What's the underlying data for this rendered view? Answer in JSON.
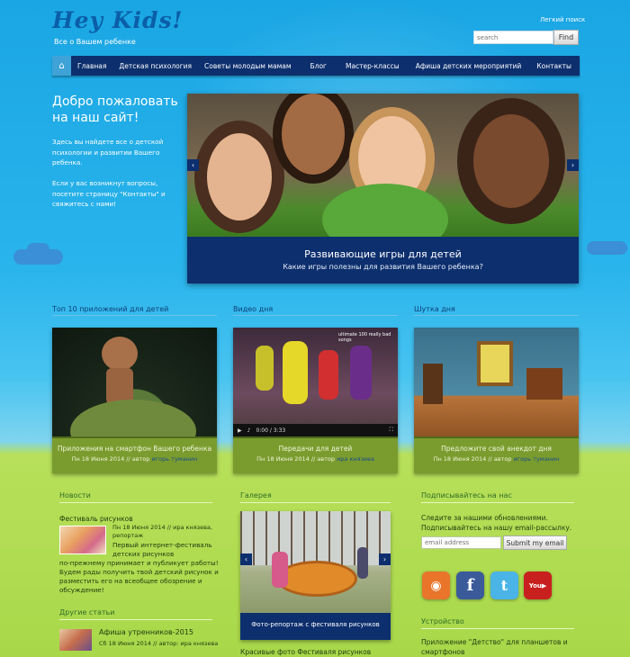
{
  "header": {
    "logo": "Hey Kids!",
    "tagline": "Все о Вашем ребенке"
  },
  "search": {
    "title": "Легкий поиск",
    "placeholder": "search",
    "button": "Find"
  },
  "nav": {
    "home_icon": "home-icon",
    "items": [
      "Главная",
      "Детская психология",
      "Советы молодым мамам",
      "Блог",
      "Мастер-классы",
      "Афиша детских мероприятий",
      "Контакты"
    ]
  },
  "welcome": {
    "title": "Добро пожаловать на наш сайт!",
    "p1": "Здесь вы найдете все о детской психологии и развитии Вашего ребенка.",
    "p2": "Если у вас возникнут вопросы, посетите страницу \"Контакты\" и свяжитесь с нами!"
  },
  "slider": {
    "title": "Развивающие игры для детей",
    "subtitle": "Какие игры полезны для развития Вашего ребенка?",
    "prev": "‹",
    "next": "›"
  },
  "sections": {
    "top_apps": "Топ 10 приложений для детей",
    "video": "Видео дня",
    "joke": "Шутка дня"
  },
  "cards": [
    {
      "title": "Приложения на смартфон Вашего ребенка",
      "date": "Пн 18 Июня 2014 // автор",
      "author": "игорь туманин"
    },
    {
      "title": "Передачи для детей",
      "date": "Пн 18 Июня 2014 // автор",
      "author": "ира князева",
      "video_time": "0:00 / 3:33",
      "video_text": "ultimate 100 really bad songs"
    },
    {
      "title": "Предложите свой анекдот дня",
      "date": "Пн 18 Июня 2014 // автор",
      "author": "игорь туманин"
    }
  ],
  "news": {
    "head": "Новости",
    "item_title": "Фестиваль рисунков",
    "item_meta": "Пн 18 Июня 2014 // ира князева, репортаж",
    "item_body_1": "Первый интернет-фестиваль детских рисунков",
    "item_body_2": "по-прежнему принимает и публикует работы! Будем рады получить твой детский рисунок и разместить его на всеобщее обозрение и обсуждение!",
    "other_head": "Другие статьи",
    "other_title": "Афиша утренников-2015",
    "other_meta": "Сб 18 Июня 2014 // автор: ира князева"
  },
  "gallery": {
    "head": "Галерея",
    "caption": "Фото-репортаж с фестиваля рисунков",
    "desc": "Красивые фото Фестиваля рисунков"
  },
  "subscribe": {
    "head": "Подписывайтесь на нас",
    "text": "Следите за нашими обновлениями. Подписывайтесь на нашу email-рассылку.",
    "placeholder": "email address",
    "button": "Submit my email",
    "social": [
      "rss-icon",
      "facebook-icon",
      "twitter-icon",
      "youtube-icon"
    ]
  },
  "device": {
    "head": "Устройство",
    "text": "Приложение \"Детство\" для планшетов и смартфонов"
  }
}
